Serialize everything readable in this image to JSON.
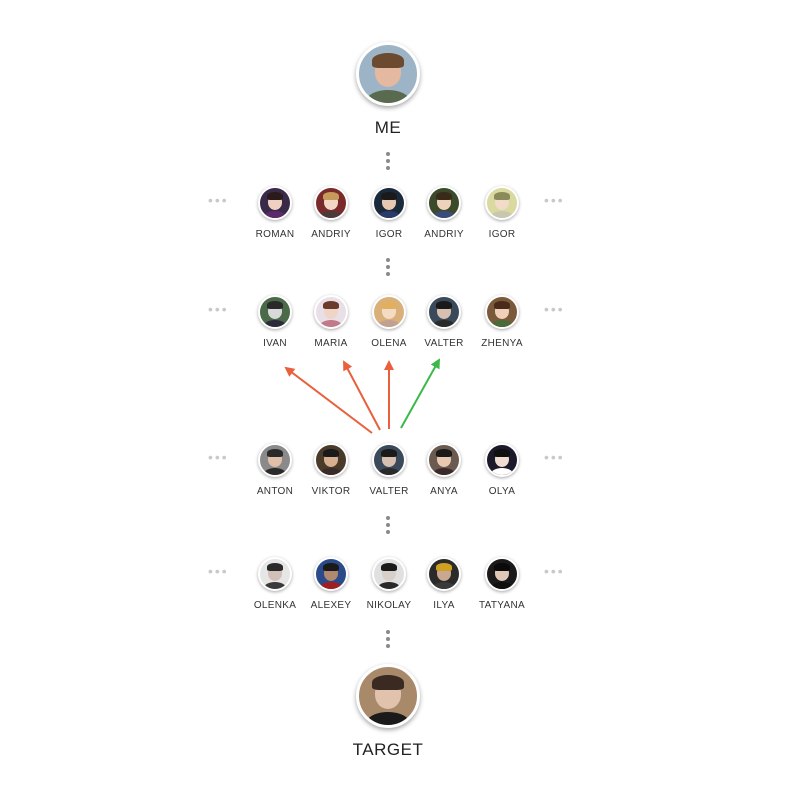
{
  "me": {
    "label": "ME",
    "skin": "#e4b9a0",
    "hair": "#6b4a2f",
    "shirt": "#5a6a4e",
    "bg": "#9db3c6"
  },
  "target": {
    "label": "TARGET",
    "skin": "#e0c2ad",
    "hair": "#3a2a22",
    "shirt": "#1a1a1a",
    "bg": "#a88a6a"
  },
  "rows": [
    {
      "people": [
        {
          "name": "ROMAN",
          "bg": "#3a2a4a",
          "skin": "#f0d0c0",
          "hair": "#2a1a1a",
          "shirt": "#5a2a6a"
        },
        {
          "name": "ANDRIY",
          "bg": "#7a2a2a",
          "skin": "#f3d7c4",
          "hair": "#c59a5a",
          "shirt": "#4a3a3a"
        },
        {
          "name": "IGOR",
          "bg": "#1a2a3a",
          "skin": "#e8c8b0",
          "hair": "#1a1a1a",
          "shirt": "#2a3a6a"
        },
        {
          "name": "ANDRIY",
          "bg": "#3a4a2a",
          "skin": "#eed2bc",
          "hair": "#3a2a1a",
          "shirt": "#3a4a7a"
        },
        {
          "name": "IGOR",
          "bg": "#d9d9a0",
          "skin": "#f2dbc8",
          "hair": "#8a8a5a",
          "shirt": "#c8c8b0"
        }
      ]
    },
    {
      "people": [
        {
          "name": "IVAN",
          "bg": "#4a6a4a",
          "skin": "#d9d9d9",
          "hair": "#2a2a2a",
          "shirt": "#2a2a3a"
        },
        {
          "name": "MARIA",
          "bg": "#e8e0e6",
          "skin": "#f0d4c8",
          "hair": "#6a3a2a",
          "shirt": "#c07a8a"
        },
        {
          "name": "OLENA",
          "bg": "#d9b07a",
          "skin": "#f4dcc4",
          "hair": "#e0b060",
          "shirt": "#c0a090"
        },
        {
          "name": "VALTER",
          "bg": "#3a4a5a",
          "skin": "#d8c0b0",
          "hair": "#1a1a1a",
          "shirt": "#2a2a2a"
        },
        {
          "name": "ZHENYA",
          "bg": "#7a5a3a",
          "skin": "#f0d0b8",
          "hair": "#4a2a1a",
          "shirt": "#4a6a3a"
        }
      ]
    },
    {
      "people": [
        {
          "name": "ANTON",
          "bg": "#8a8a8a",
          "skin": "#e0c0a8",
          "hair": "#2a2a2a",
          "shirt": "#2a2a2a"
        },
        {
          "name": "VIKTOR",
          "bg": "#4a3a2a",
          "skin": "#d8b090",
          "hair": "#1a1a1a",
          "shirt": "#3a2a2a"
        },
        {
          "name": "VALTER",
          "bg": "#3a4a5a",
          "skin": "#d8c0b0",
          "hair": "#1a1a1a",
          "shirt": "#2a2a2a"
        },
        {
          "name": "ANYA",
          "bg": "#6a5a50",
          "skin": "#e8c8b0",
          "hair": "#1a1a1a",
          "shirt": "#3a2a2a"
        },
        {
          "name": "OLYA",
          "bg": "#1a1a2a",
          "skin": "#f0dcd0",
          "hair": "#101010",
          "shirt": "#ffffff"
        }
      ]
    },
    {
      "people": [
        {
          "name": "OLENKA",
          "bg": "#e6e6e6",
          "skin": "#d0c0b8",
          "hair": "#2a2a2a",
          "shirt": "#3a3a3a"
        },
        {
          "name": "ALEXEY",
          "bg": "#2a4a8a",
          "skin": "#b08a70",
          "hair": "#1a1a1a",
          "shirt": "#a02020"
        },
        {
          "name": "NIKOLAY",
          "bg": "#e0e0e0",
          "skin": "#d8d0c8",
          "hair": "#1a1a1a",
          "shirt": "#2a2a2a"
        },
        {
          "name": "ILYA",
          "bg": "#2a2a2a",
          "skin": "#c8a890",
          "hair": "#d0a020",
          "shirt": "#3a3a3a"
        },
        {
          "name": "TATYANA",
          "bg": "#1a1a1a",
          "skin": "#e0c8b8",
          "hair": "#0a0a0a",
          "shirt": "#101010"
        }
      ]
    }
  ],
  "colors": {
    "red_arrow": "#e8603c",
    "green_arrow": "#3cb84a",
    "dots": "#8a8a8a",
    "side_dots": "#c9c9c9"
  }
}
